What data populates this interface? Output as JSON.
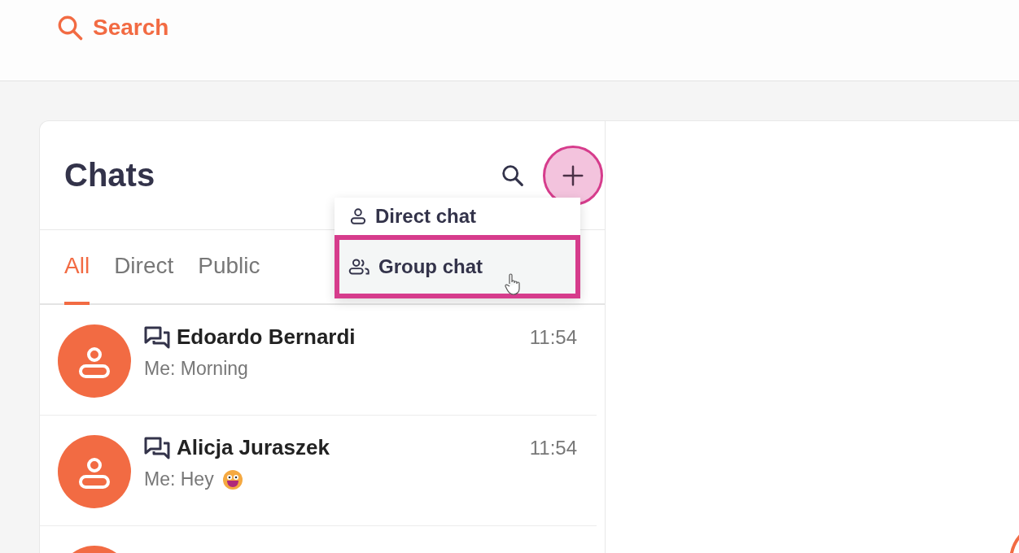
{
  "top_bar": {
    "search_label": "Search"
  },
  "chats": {
    "title": "Chats",
    "tabs": [
      {
        "label": "All",
        "selected": true
      },
      {
        "label": "Direct",
        "selected": false
      },
      {
        "label": "Public",
        "selected": false
      }
    ],
    "new_menu": {
      "items": [
        {
          "label": "Direct chat",
          "kind": "direct",
          "highlighted": false
        },
        {
          "label": "Group chat",
          "kind": "group",
          "highlighted": true
        }
      ]
    },
    "rows": [
      {
        "kind": "chat",
        "name": "Edoardo Bernardi",
        "preview": "Me: Morning",
        "time": "11:54",
        "emoji": false
      },
      {
        "kind": "chat",
        "name": "Alicja Juraszek",
        "preview": "Me: Hey",
        "time": "11:54",
        "emoji": true
      },
      {
        "kind": "partial"
      }
    ]
  }
}
